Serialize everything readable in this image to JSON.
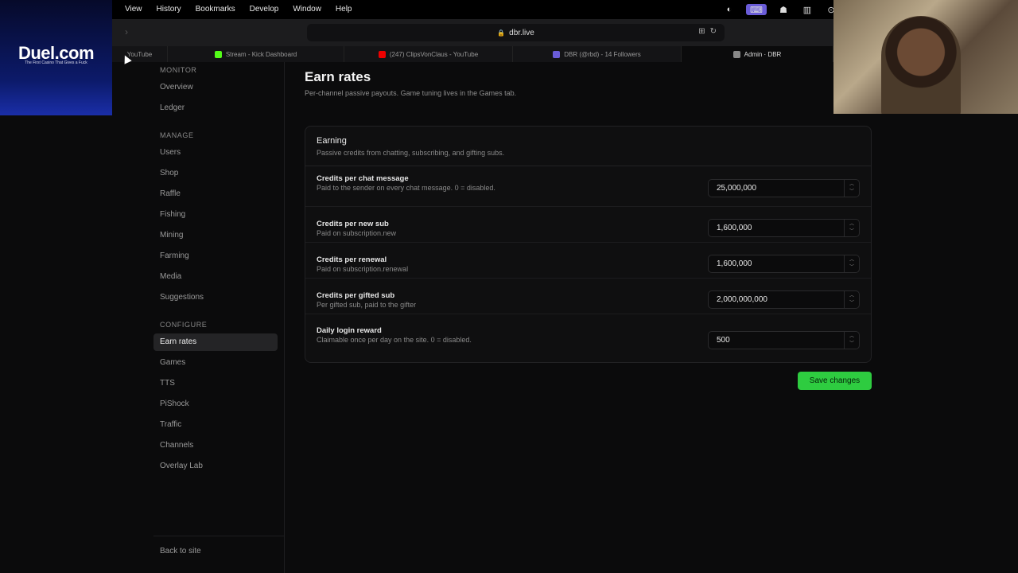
{
  "menubar": {
    "items": [
      "View",
      "History",
      "Bookmarks",
      "Develop",
      "Window",
      "Help"
    ]
  },
  "browser": {
    "url": "dbr.live",
    "tabs": [
      {
        "label": "YouTube",
        "color": "#c00"
      },
      {
        "label": "Stream - Kick Dashboard",
        "color": "#53fc18"
      },
      {
        "label": "(247) ClipsVonClaus - YouTube",
        "color": "#e00"
      },
      {
        "label": "DBR (@rbd) - 14 Followers",
        "color": "#6a5cd8"
      },
      {
        "label": "Admin · DBR",
        "color": "#888"
      }
    ]
  },
  "overlay": {
    "brand": "Duel.com",
    "tagline": "The First Casino That Gives a Fuck"
  },
  "sidebar": {
    "sections": [
      {
        "heading": "MONITOR",
        "items": [
          "Overview",
          "Ledger"
        ]
      },
      {
        "heading": "MANAGE",
        "items": [
          "Users",
          "Shop",
          "Raffle",
          "Fishing",
          "Mining",
          "Farming",
          "Media",
          "Suggestions"
        ]
      },
      {
        "heading": "CONFIGURE",
        "items": [
          "Earn rates",
          "Games",
          "TTS",
          "PiShock",
          "Traffic",
          "Channels",
          "Overlay Lab"
        ]
      }
    ],
    "active": "Earn rates",
    "back": "Back to site"
  },
  "page": {
    "title": "Earn rates",
    "subtitle": "Per-channel passive payouts. Game tuning lives in the Games tab."
  },
  "card": {
    "title": "Earning",
    "subtitle": "Passive credits from chatting, subscribing, and gifting subs.",
    "rows": [
      {
        "label": "Credits per chat message",
        "help": "Paid to the sender on every chat message. 0 = disabled.",
        "value": "25,000,000"
      },
      {
        "label": "Credits per new sub",
        "help": "Paid on subscription.new",
        "value": "1,600,000"
      },
      {
        "label": "Credits per renewal",
        "help": "Paid on subscription.renewal",
        "value": "1,600,000"
      },
      {
        "label": "Credits per gifted sub",
        "help": "Per gifted sub, paid to the gifter",
        "value": "2,000,000,000"
      },
      {
        "label": "Daily login reward",
        "help": "Claimable once per day on the site. 0 = disabled.",
        "value": "500"
      }
    ]
  },
  "save_label": "Save changes",
  "accent": "#2ecc40"
}
